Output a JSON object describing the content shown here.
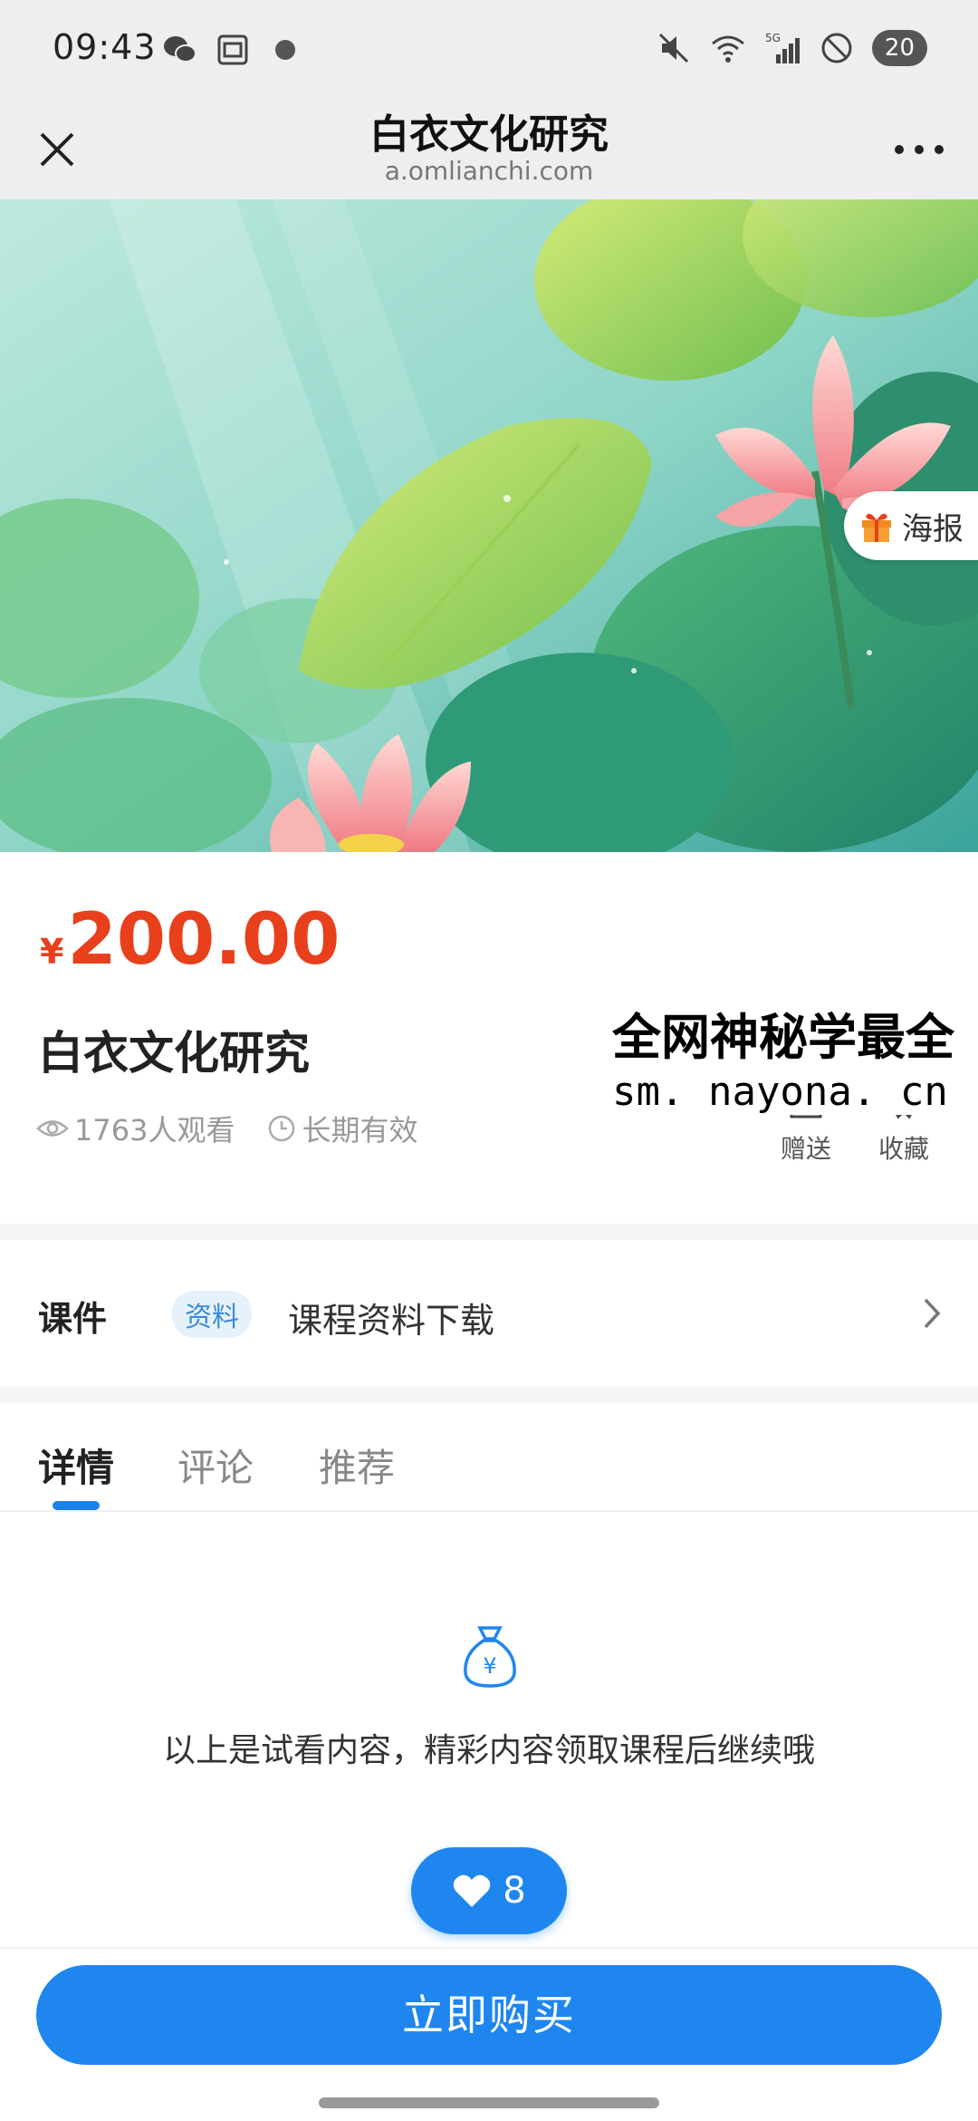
{
  "status_bar": {
    "time": "09:43",
    "battery": "20",
    "icons": [
      "wechat-icon",
      "screenshot-icon",
      "dot-icon",
      "mute-icon",
      "wifi-icon",
      "5g-signal-icon",
      "dnd-icon"
    ]
  },
  "nav": {
    "title": "白衣文化研究",
    "url": "a.omlianchi.com"
  },
  "banner": {
    "poster_label": "海报"
  },
  "course": {
    "currency": "¥",
    "price": "200.00",
    "title": "白衣文化研究",
    "views": "1763人观看",
    "validity": "长期有效"
  },
  "watermark": {
    "line1": "全网神秘学最全",
    "line2": "sm. nayona. cn"
  },
  "actions": {
    "gift_label": "赠送",
    "favorite_label": "收藏"
  },
  "courseware": {
    "label": "课件",
    "badge": "资料",
    "text": "课程资料下载"
  },
  "tabs": {
    "detail": "详情",
    "comment": "评论",
    "recommend": "推荐"
  },
  "detail": {
    "trial_text": "以上是试看内容，精彩内容领取课程后继续哦",
    "like_count": "8"
  },
  "bottom": {
    "buy_label": "立即购买"
  },
  "colors": {
    "price": "#e8401c",
    "accent": "#1f86f0",
    "badge_bg": "#e6f2fb"
  }
}
